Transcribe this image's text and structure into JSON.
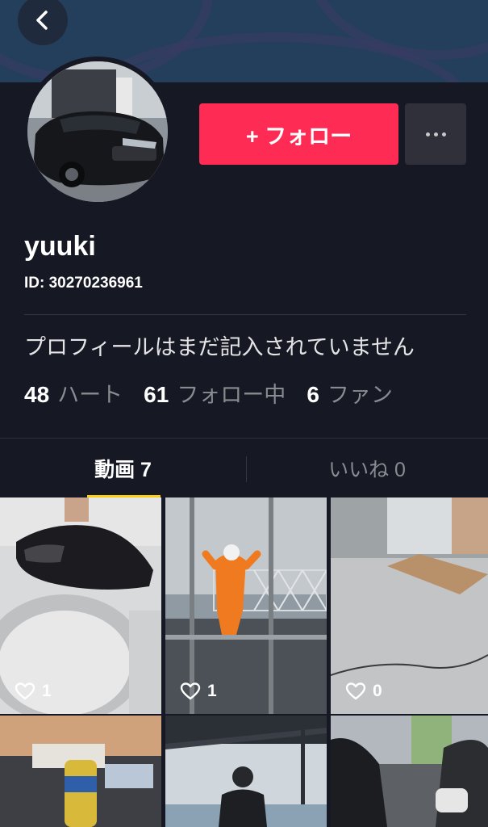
{
  "profile": {
    "follow_label": "+ フォロー",
    "username": "yuuki",
    "id_text": "ID: 30270236961",
    "bio": "プロフィールはまだ記入されていません"
  },
  "stats": [
    {
      "value": "48",
      "label": "ハート"
    },
    {
      "value": "61",
      "label": "フォロー中"
    },
    {
      "value": "6",
      "label": "ファン"
    }
  ],
  "tabs": [
    {
      "label": "動画 7",
      "active": true
    },
    {
      "label": "いいね 0",
      "active": false
    }
  ],
  "videos": [
    {
      "likes": "1"
    },
    {
      "likes": "1"
    },
    {
      "likes": "0"
    }
  ],
  "colors": {
    "background": "#161823",
    "follow_button": "#fe2c55",
    "tab_indicator": "#face15",
    "banner": "#233f5c"
  },
  "icons": {
    "back": "chevron-left-icon",
    "more": "more-dots-icon",
    "like": "heart-outline-icon"
  }
}
